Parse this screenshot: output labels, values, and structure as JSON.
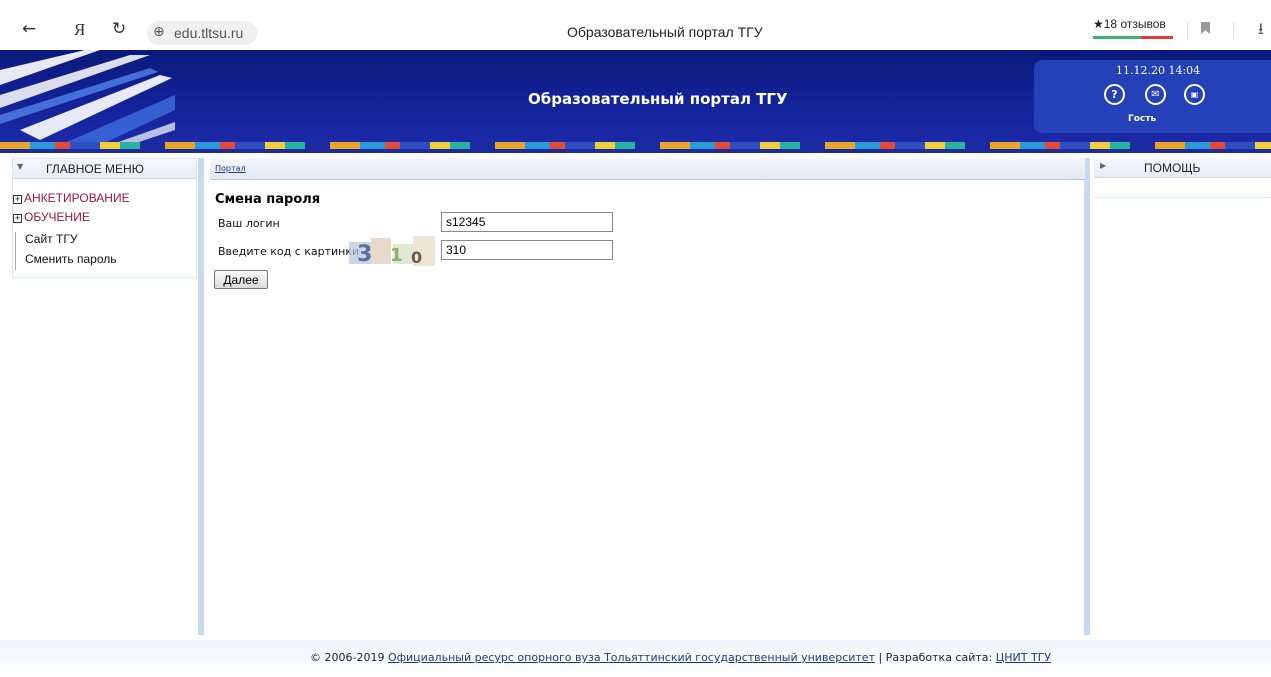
{
  "browser": {
    "back": "←",
    "yandex": "Я",
    "reload": "↻",
    "url": "edu.tltsu.ru",
    "tab_title": "Образовательный портал ТГУ",
    "reviews": "★18 отзывов",
    "download": "⭳"
  },
  "header": {
    "title": "Образовательный портал ТГУ",
    "datetime": "11.12.20 14:04",
    "help_icon": "?",
    "mail_icon": "✉",
    "lock_icon": "🔒",
    "user": "Гость"
  },
  "left_menu": {
    "title": "ГЛАВНОЕ МЕНЮ",
    "items": [
      {
        "label": "АНКЕТИРОВАНИЕ",
        "expander": "+"
      },
      {
        "label": "ОБУЧЕНИЕ",
        "expander": "+"
      }
    ],
    "sub_items": [
      "Сайт ТГУ",
      "Сменить пароль"
    ]
  },
  "main": {
    "breadcrumb": "Портал",
    "section_title": "Смена пароля",
    "login_label": "Ваш логин",
    "login_value": "s12345",
    "captcha_label": "Введите код с картинки",
    "captcha_digits": [
      "3",
      "1",
      "0"
    ],
    "captcha_value": "310",
    "next_button": "Далее"
  },
  "right_panel": {
    "title": "ПОМОЩЬ"
  },
  "footer": {
    "copyright": "© 2006-2019",
    "resource_link": "Официальный ресурс опорного вуза Тольяттинский государственный университет",
    "separator": "| Разработка сайта:",
    "dev_link": "ЦНИТ ТГУ"
  }
}
